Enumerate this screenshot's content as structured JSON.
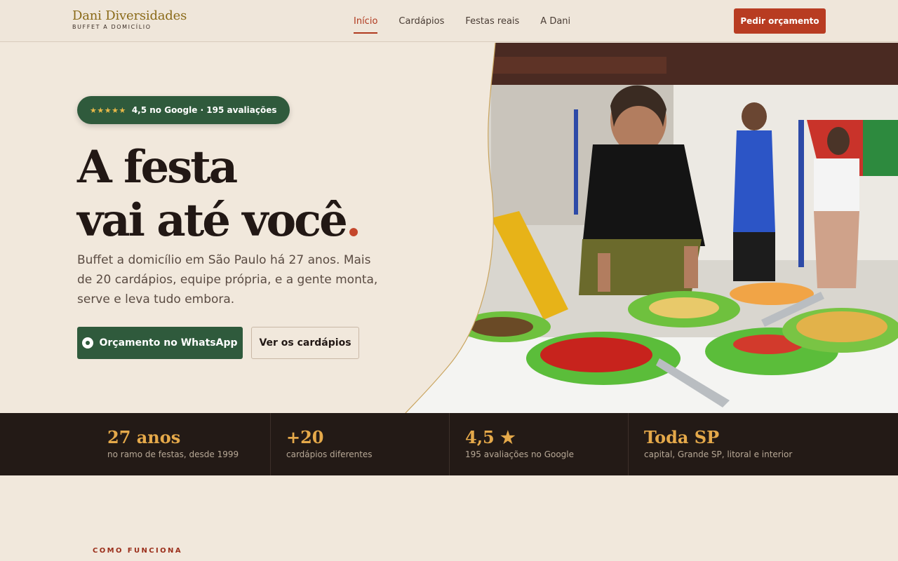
{
  "brand": {
    "name": "Dani Diversidades",
    "tagline": "BUFFET A DOMICÍLIO"
  },
  "nav": {
    "items": [
      {
        "label": "Início",
        "active": true
      },
      {
        "label": "Cardápios",
        "active": false
      },
      {
        "label": "Festas reais",
        "active": false
      },
      {
        "label": "A Dani",
        "active": false
      }
    ],
    "cta_label": "Pedir orçamento"
  },
  "hero": {
    "badge": {
      "stars": "★★★★★",
      "text": "4,5 no Google · 195 avaliações"
    },
    "title_line1": "A festa",
    "title_line2": "vai até você",
    "title_dot": ".",
    "lead": "Buffet a domicílio em São Paulo há 27 anos. Mais de 20 cardápios, equipe própria, e a gente monta, serve e leva tudo embora.",
    "primary_button": "Orçamento no WhatsApp",
    "secondary_button": "Ver os cardápios"
  },
  "stats": [
    {
      "value": "27 anos",
      "label": "no ramo de festas, desde 1999"
    },
    {
      "value": "+20",
      "label": "cardápios diferentes"
    },
    {
      "value": "4,5 ★",
      "label": "195 avaliações no Google"
    },
    {
      "value": "Toda SP",
      "label": "capital, Grande SP, litoral e interior"
    }
  ],
  "next_section_label": "COMO FUNCIONA",
  "colors": {
    "background": "#f1e8dc",
    "accent_red": "#b83c22",
    "accent_green": "#2f5a3c",
    "gold": "#e5a94a",
    "dark": "#231a16"
  }
}
